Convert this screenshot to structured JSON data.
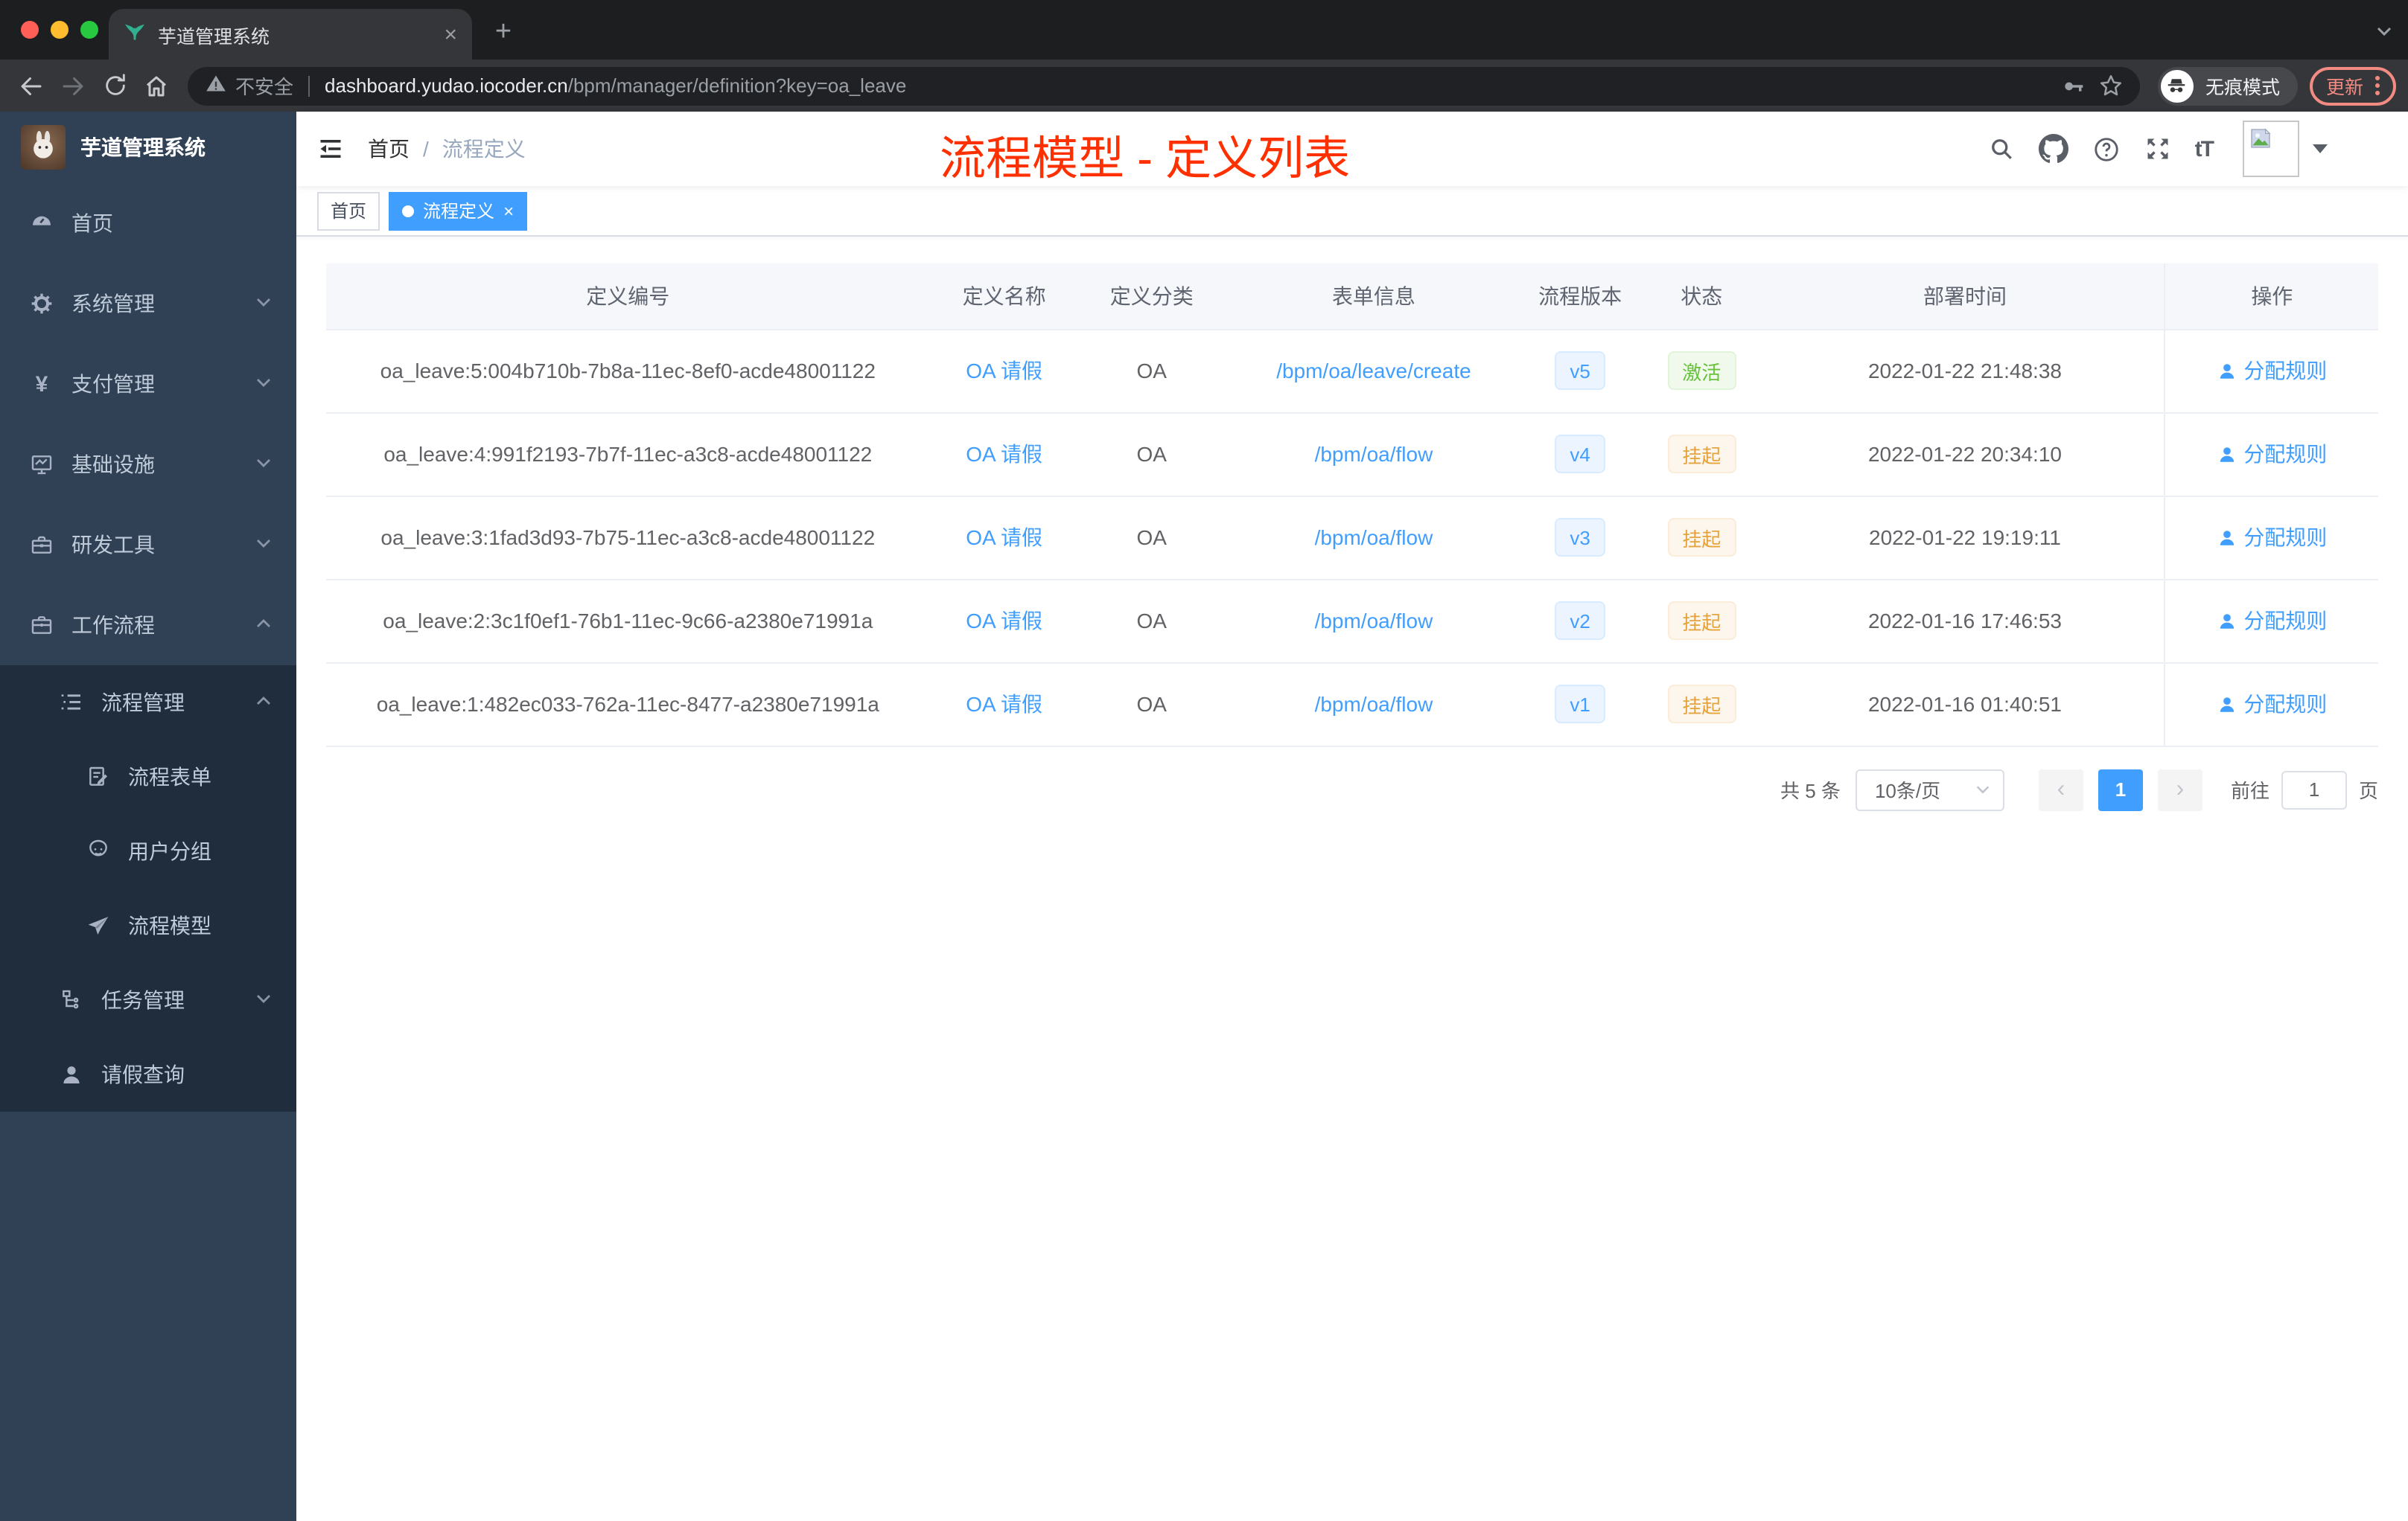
{
  "colors": {
    "primary": "#409eff",
    "success": "#67c23a",
    "warning": "#e6a23c",
    "annotation_red": "#ff3000",
    "sidebar_bg": "#304156",
    "submenu_bg": "#1f2d3d"
  },
  "browser": {
    "tab_title": "芋道管理系统",
    "tab_close": "×",
    "new_tab": "+",
    "security_label": "不安全",
    "url_host": "dashboard.yudao.iocoder.cn",
    "url_path": "/bpm/manager/definition?key=oa_leave",
    "incognito_label": "无痕模式",
    "update_label": "更新"
  },
  "sidebar": {
    "title": "芋道管理系统",
    "items": [
      {
        "label": "首页"
      },
      {
        "label": "系统管理"
      },
      {
        "label": "支付管理"
      },
      {
        "label": "基础设施"
      },
      {
        "label": "研发工具"
      },
      {
        "label": "工作流程"
      },
      {
        "label": "流程管理"
      },
      {
        "label": "流程表单"
      },
      {
        "label": "用户分组"
      },
      {
        "label": "流程模型"
      },
      {
        "label": "任务管理"
      },
      {
        "label": "请假查询"
      }
    ]
  },
  "navbar": {
    "breadcrumb_home": "首页",
    "breadcrumb_sep": "/",
    "breadcrumb_current": "流程定义",
    "annotation": "流程模型 - 定义列表",
    "fontsize_glyph": "tT"
  },
  "tags": {
    "home": "首页",
    "active": "流程定义",
    "close": "×"
  },
  "table": {
    "columns": [
      "定义编号",
      "定义名称",
      "定义分类",
      "表单信息",
      "流程版本",
      "状态",
      "部署时间",
      "操作"
    ],
    "action_label": "分配规则",
    "rows": [
      {
        "id": "oa_leave:5:004b710b-7b8a-11ec-8ef0-acde48001122",
        "name": "OA 请假",
        "category": "OA",
        "form": "/bpm/oa/leave/create",
        "version": "v5",
        "status": "激活",
        "time": "2022-01-22 21:48:38"
      },
      {
        "id": "oa_leave:4:991f2193-7b7f-11ec-a3c8-acde48001122",
        "name": "OA 请假",
        "category": "OA",
        "form": "/bpm/oa/flow",
        "version": "v4",
        "status": "挂起",
        "time": "2022-01-22 20:34:10"
      },
      {
        "id": "oa_leave:3:1fad3d93-7b75-11ec-a3c8-acde48001122",
        "name": "OA 请假",
        "category": "OA",
        "form": "/bpm/oa/flow",
        "version": "v3",
        "status": "挂起",
        "time": "2022-01-22 19:19:11"
      },
      {
        "id": "oa_leave:2:3c1f0ef1-76b1-11ec-9c66-a2380e71991a",
        "name": "OA 请假",
        "category": "OA",
        "form": "/bpm/oa/flow",
        "version": "v2",
        "status": "挂起",
        "time": "2022-01-16 17:46:53"
      },
      {
        "id": "oa_leave:1:482ec033-762a-11ec-8477-a2380e71991a",
        "name": "OA 请假",
        "category": "OA",
        "form": "/bpm/oa/flow",
        "version": "v1",
        "status": "挂起",
        "time": "2022-01-16 01:40:51"
      }
    ]
  },
  "pagination": {
    "total": "共 5 条",
    "page_size": "10条/页",
    "prev": "‹",
    "next": "›",
    "page": "1",
    "goto_label": "前往",
    "goto_value": "1",
    "page_unit": "页"
  }
}
